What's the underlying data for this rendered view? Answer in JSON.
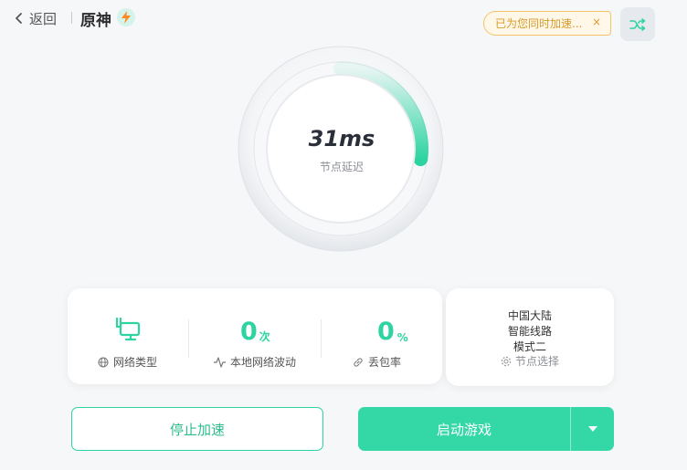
{
  "header": {
    "back_label": "返回",
    "game_title": "原神",
    "toast_text": "已为您同时加速...",
    "toast_close": "×"
  },
  "gauge": {
    "latency_value": "31ms",
    "latency_label": "节点延迟",
    "ring_fill_fraction": 0.27,
    "accent_color": "#2dd4a1"
  },
  "stats": {
    "network_type_label": "网络类型",
    "fluctuation_value": "0",
    "fluctuation_unit": "次",
    "fluctuation_label": "本地网络波动",
    "loss_value": "0",
    "loss_unit": "%",
    "loss_label": "丢包率"
  },
  "node": {
    "region": "中国大陆",
    "route": "智能线路",
    "mode": "模式二",
    "select_label": "节点选择"
  },
  "actions": {
    "stop_label": "停止加速",
    "start_label": "启动游戏"
  }
}
